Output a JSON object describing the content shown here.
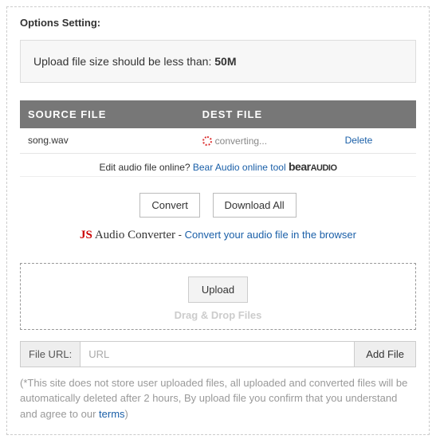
{
  "title": "Options Setting:",
  "notice_prefix": "Upload file size should be less than: ",
  "notice_bold": "50M",
  "table": {
    "headers": [
      "SOURCE FILE",
      "DEST FILE",
      ""
    ],
    "rows": [
      {
        "source": "song.wav",
        "status": "converting...",
        "action": "Delete"
      }
    ]
  },
  "editline": {
    "prefix": "Edit audio file online? ",
    "link": "Bear Audio online tool"
  },
  "buttons": {
    "convert": "Convert",
    "download_all": "Download All"
  },
  "jsline": {
    "sep": " - ",
    "link": "Convert your audio file in the browser"
  },
  "upload": {
    "button": "Upload",
    "droptext": "Drag & Drop Files"
  },
  "urlrow": {
    "label": "File URL:",
    "placeholder": "URL",
    "addbtn": "Add File"
  },
  "disclaimer": {
    "text": "(*This site does not store user uploaded files, all uploaded and converted files will be automatically deleted after 2 hours, By upload file you confirm that you understand and agree to our ",
    "terms": "terms",
    "suffix": ")"
  }
}
